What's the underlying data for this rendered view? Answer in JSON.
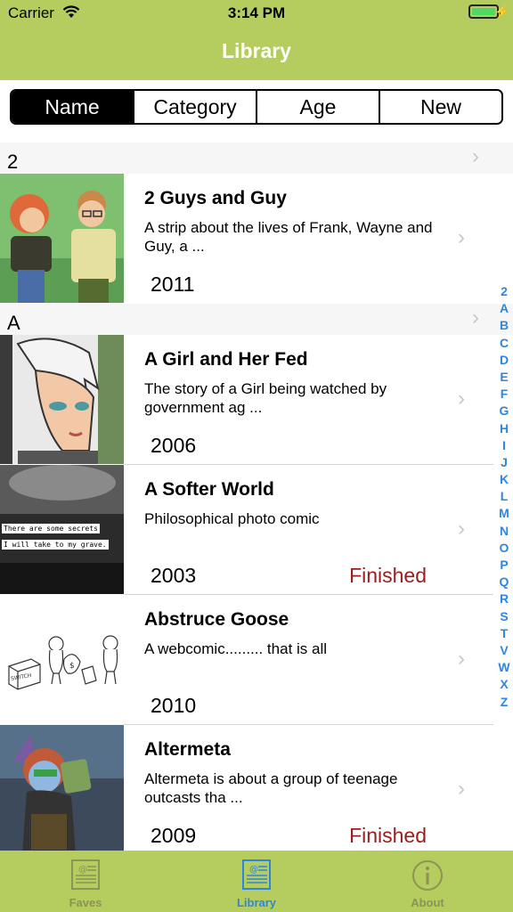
{
  "status_bar": {
    "carrier": "Carrier",
    "time": "3:14 PM"
  },
  "nav": {
    "title": "Library"
  },
  "segments": [
    {
      "label": "Name",
      "active": true
    },
    {
      "label": "Category",
      "active": false
    },
    {
      "label": "Age",
      "active": false
    },
    {
      "label": "New",
      "active": false
    }
  ],
  "sections": [
    {
      "header": "2"
    },
    {
      "header": "A"
    }
  ],
  "rows": [
    {
      "title": "2 Guys and Guy",
      "description": "A strip about the lives of Frank, Wayne and Guy, a ...",
      "year": "2011",
      "status": ""
    },
    {
      "title": "A Girl and Her Fed",
      "description": "The story of a Girl being watched by government ag ...",
      "year": "2006",
      "status": ""
    },
    {
      "title": "A Softer World",
      "description": "Philosophical photo comic",
      "year": "2003",
      "status": "Finished"
    },
    {
      "title": "Abstruce Goose",
      "description": "A webcomic......... that is all",
      "year": "2010",
      "status": ""
    },
    {
      "title": "Altermeta",
      "description": "Altermeta is about a group of teenage outcasts tha ...",
      "year": "2009",
      "status": "Finished"
    }
  ],
  "thumbnails": {
    "softer_world": {
      "line1": "There are some secrets",
      "line2": "I will take to my grave."
    },
    "abstruce_goose": {
      "box_label": "SWITCH"
    }
  },
  "index_letters": [
    "2",
    "A",
    "B",
    "C",
    "D",
    "E",
    "F",
    "G",
    "H",
    "I",
    "J",
    "K",
    "L",
    "M",
    "N",
    "O",
    "P",
    "Q",
    "R",
    "S",
    "T",
    "V",
    "W",
    "X",
    "Z"
  ],
  "tabs": [
    {
      "label": "Faves",
      "icon": "newspaper-icon",
      "active": false
    },
    {
      "label": "Library",
      "icon": "newspaper-icon",
      "active": true
    },
    {
      "label": "About",
      "icon": "info-icon",
      "active": false
    }
  ],
  "colors": {
    "nav_bar": "#b5cc5e",
    "accent": "#2e86e0",
    "finished": "#9b1c1c"
  }
}
